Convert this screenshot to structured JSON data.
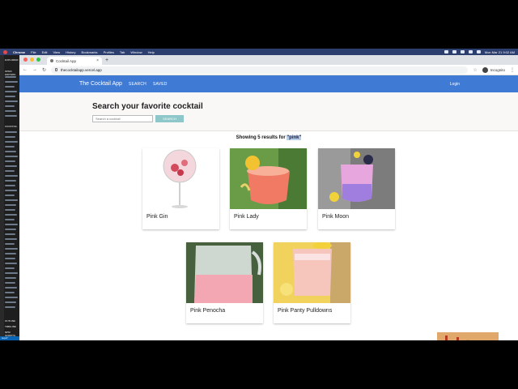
{
  "menubar": {
    "app": "Chrome",
    "items": [
      "File",
      "Edit",
      "View",
      "History",
      "Bookmarks",
      "Profiles",
      "Tab",
      "Window",
      "Help"
    ],
    "clock": "Mon Mar 21  9:02 AM"
  },
  "vscode": {
    "explorer": "EXPLORER",
    "open_editors": "OPEN EDITORS",
    "project": "COCKTAIL",
    "outline": "OUTLINE",
    "timeline": "TIMELINE",
    "npm": "NPM SCRIPTS",
    "branch": "supa*"
  },
  "browser": {
    "tab_title": "Cocktail App",
    "url": "thecocktailapp.vercel.app",
    "profile": "Incognito"
  },
  "app": {
    "brand": "The Cocktail App",
    "nav": [
      "SEARCH",
      "SAVED"
    ],
    "login": "Login",
    "heading": "Search your favorite cocktail",
    "search_placeholder": "Search a cocktail",
    "search_button": "SEARCH",
    "results_prefix": "Showing 5 results for ",
    "results_query": "\"pink\"",
    "colors": {
      "appbar": "#3f7ad4",
      "search_button": "#8ec7c9"
    }
  },
  "cocktails": [
    {
      "name": "Pink Gin"
    },
    {
      "name": "Pink Lady"
    },
    {
      "name": "Pink Moon"
    },
    {
      "name": "Pink Penocha"
    },
    {
      "name": "Pink Panty Pulldowns"
    }
  ]
}
